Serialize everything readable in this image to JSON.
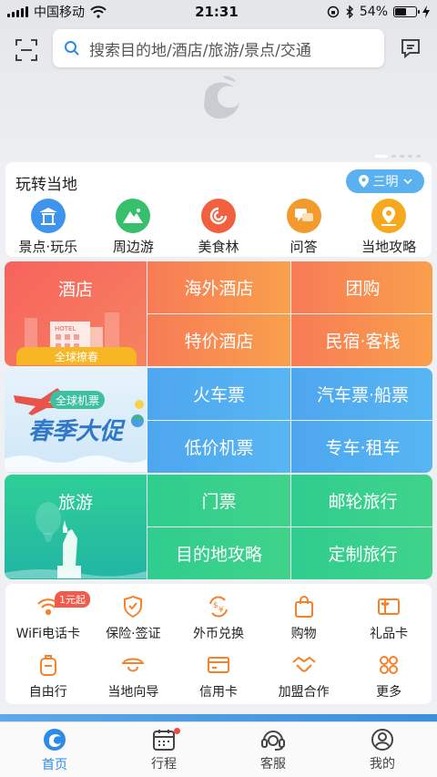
{
  "status_bar": {
    "carrier": "中国移动",
    "time": "21:31",
    "battery": "54%",
    "battery_level": 0.54
  },
  "header": {
    "search_placeholder": "搜索目的地/酒店/旅游/景点/交通"
  },
  "local": {
    "title": "玩转当地",
    "city": "三明",
    "items": [
      {
        "label": "景点·玩乐",
        "icon": "pavilion-icon",
        "color": "#3e94ec"
      },
      {
        "label": "周边游",
        "icon": "mountain-icon",
        "color": "#36c06c"
      },
      {
        "label": "美食林",
        "icon": "food-icon",
        "color": "#f2613f"
      },
      {
        "label": "问答",
        "icon": "chat-bubbles-icon",
        "color": "#f39a2c"
      },
      {
        "label": "当地攻略",
        "icon": "map-pin-icon",
        "color": "#f6a81e"
      }
    ]
  },
  "grid_hotel": {
    "title": "酒店",
    "promo": "全球撩春",
    "cells": [
      "海外酒店",
      "团购",
      "特价酒店",
      "民宿·客栈"
    ],
    "hotel_sign": "HOTEL"
  },
  "grid_transport": {
    "promo_tag": "全球机票",
    "promo_title": "春季大促",
    "cells": [
      "火车票",
      "汽车票·船票",
      "低价机票",
      "专车·租车"
    ]
  },
  "grid_travel": {
    "title": "旅游",
    "cells": [
      "门票",
      "邮轮旅行",
      "目的地攻略",
      "定制旅行"
    ]
  },
  "services": {
    "badge": "1元起",
    "row1": [
      {
        "label": "WiFi电话卡",
        "icon": "wifi-icon"
      },
      {
        "label": "保险·签证",
        "icon": "shield-icon"
      },
      {
        "label": "外币兑换",
        "icon": "currency-exchange-icon"
      },
      {
        "label": "购物",
        "icon": "shopping-bag-icon"
      },
      {
        "label": "礼品卡",
        "icon": "gift-card-icon"
      }
    ],
    "row2": [
      {
        "label": "自由行",
        "icon": "backpack-icon"
      },
      {
        "label": "当地向导",
        "icon": "guide-hat-icon"
      },
      {
        "label": "信用卡",
        "icon": "credit-card-icon"
      },
      {
        "label": "加盟合作",
        "icon": "handshake-icon"
      },
      {
        "label": "更多",
        "icon": "more-icon"
      }
    ],
    "accent": "#f5822a"
  },
  "tabbar": [
    {
      "label": "首页",
      "icon": "dolphin-home-icon",
      "active": true
    },
    {
      "label": "行程",
      "icon": "calendar-icon",
      "active": false
    },
    {
      "label": "客服",
      "icon": "headset-icon",
      "active": false
    },
    {
      "label": "我的",
      "icon": "user-icon",
      "active": false
    }
  ]
}
